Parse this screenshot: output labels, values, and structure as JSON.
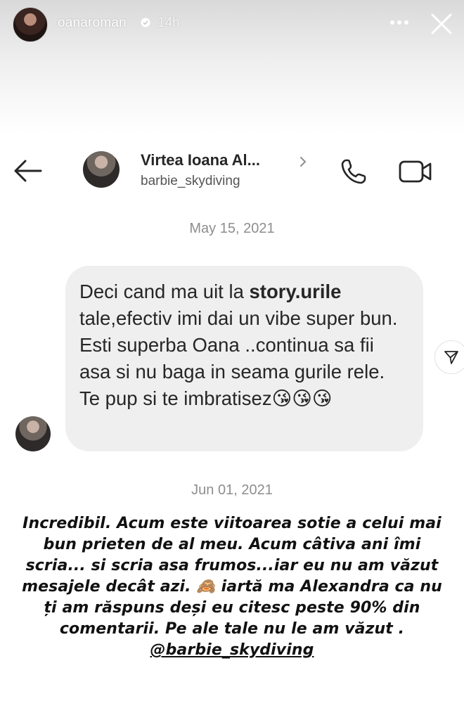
{
  "story": {
    "username": "oanaroman",
    "time": "14h"
  },
  "chat": {
    "contact_name": "Virtea Ioana Al...",
    "contact_handle": "barbie_skydiving"
  },
  "messages": {
    "date_1": "May 15, 2021",
    "bubble_pre": "Deci cand ma uit la ",
    "bubble_bold": "story.urile",
    "bubble_post": " tale,efectiv imi dai un vibe super bun. Esti superba Oana ..continua sa fii asa si nu baga in seama gurile rele. Te pup si te imbratisez😘😘😘",
    "date_2": "Jun 01, 2021"
  },
  "caption": {
    "text": "Incredibil. Acum este viitoarea sotie a celui mai bun prieten de al meu. Acum câtiva ani îmi scria... si scria asa frumos...iar eu nu am văzut mesajele decât azi. 🙈 iartă ma Alexandra ca nu ți am răspuns deși eu citesc peste 90% din comentarii. Pe ale tale nu le am văzut .",
    "mention": "@barbie_skydiving"
  },
  "icons": {
    "more": "more-horizontal-icon",
    "close": "close-icon",
    "back": "arrow-left-icon",
    "call": "phone-icon",
    "video": "video-camera-icon",
    "share": "send-icon"
  },
  "colors": {
    "bubble": "#efefef",
    "verified": "#ffffff",
    "muted_text": "#8e8e8e"
  }
}
